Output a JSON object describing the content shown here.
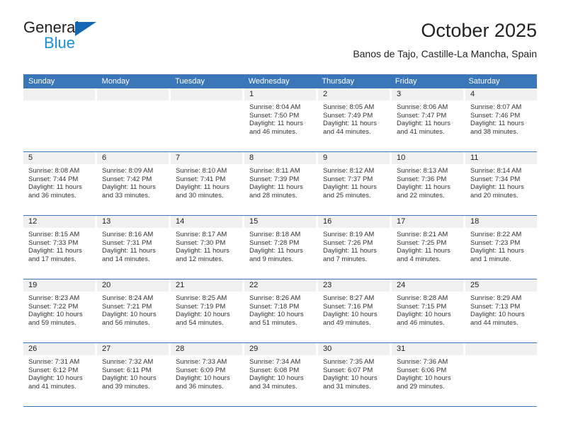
{
  "brand": {
    "name_part1": "General",
    "name_part2": "Blue",
    "accent_color": "#1268b3",
    "blue_text_color": "#1a8fdd"
  },
  "header": {
    "title": "October 2025",
    "subtitle": "Banos de Tajo, Castille-La Mancha, Spain",
    "header_bg_color": "#3b76b8"
  },
  "weekdays": [
    "Sunday",
    "Monday",
    "Tuesday",
    "Wednesday",
    "Thursday",
    "Friday",
    "Saturday"
  ],
  "weeks": [
    [
      {
        "day": "",
        "empty": true,
        "lines": []
      },
      {
        "day": "",
        "empty": true,
        "lines": []
      },
      {
        "day": "",
        "empty": true,
        "lines": []
      },
      {
        "day": "1",
        "empty": false,
        "lines": [
          "Sunrise: 8:04 AM",
          "Sunset: 7:50 PM",
          "Daylight: 11 hours",
          "and 46 minutes."
        ]
      },
      {
        "day": "2",
        "empty": false,
        "lines": [
          "Sunrise: 8:05 AM",
          "Sunset: 7:49 PM",
          "Daylight: 11 hours",
          "and 44 minutes."
        ]
      },
      {
        "day": "3",
        "empty": false,
        "lines": [
          "Sunrise: 8:06 AM",
          "Sunset: 7:47 PM",
          "Daylight: 11 hours",
          "and 41 minutes."
        ]
      },
      {
        "day": "4",
        "empty": false,
        "lines": [
          "Sunrise: 8:07 AM",
          "Sunset: 7:46 PM",
          "Daylight: 11 hours",
          "and 38 minutes."
        ]
      }
    ],
    [
      {
        "day": "5",
        "empty": false,
        "lines": [
          "Sunrise: 8:08 AM",
          "Sunset: 7:44 PM",
          "Daylight: 11 hours",
          "and 36 minutes."
        ]
      },
      {
        "day": "6",
        "empty": false,
        "lines": [
          "Sunrise: 8:09 AM",
          "Sunset: 7:42 PM",
          "Daylight: 11 hours",
          "and 33 minutes."
        ]
      },
      {
        "day": "7",
        "empty": false,
        "lines": [
          "Sunrise: 8:10 AM",
          "Sunset: 7:41 PM",
          "Daylight: 11 hours",
          "and 30 minutes."
        ]
      },
      {
        "day": "8",
        "empty": false,
        "lines": [
          "Sunrise: 8:11 AM",
          "Sunset: 7:39 PM",
          "Daylight: 11 hours",
          "and 28 minutes."
        ]
      },
      {
        "day": "9",
        "empty": false,
        "lines": [
          "Sunrise: 8:12 AM",
          "Sunset: 7:37 PM",
          "Daylight: 11 hours",
          "and 25 minutes."
        ]
      },
      {
        "day": "10",
        "empty": false,
        "lines": [
          "Sunrise: 8:13 AM",
          "Sunset: 7:36 PM",
          "Daylight: 11 hours",
          "and 22 minutes."
        ]
      },
      {
        "day": "11",
        "empty": false,
        "lines": [
          "Sunrise: 8:14 AM",
          "Sunset: 7:34 PM",
          "Daylight: 11 hours",
          "and 20 minutes."
        ]
      }
    ],
    [
      {
        "day": "12",
        "empty": false,
        "lines": [
          "Sunrise: 8:15 AM",
          "Sunset: 7:33 PM",
          "Daylight: 11 hours",
          "and 17 minutes."
        ]
      },
      {
        "day": "13",
        "empty": false,
        "lines": [
          "Sunrise: 8:16 AM",
          "Sunset: 7:31 PM",
          "Daylight: 11 hours",
          "and 14 minutes."
        ]
      },
      {
        "day": "14",
        "empty": false,
        "lines": [
          "Sunrise: 8:17 AM",
          "Sunset: 7:30 PM",
          "Daylight: 11 hours",
          "and 12 minutes."
        ]
      },
      {
        "day": "15",
        "empty": false,
        "lines": [
          "Sunrise: 8:18 AM",
          "Sunset: 7:28 PM",
          "Daylight: 11 hours",
          "and 9 minutes."
        ]
      },
      {
        "day": "16",
        "empty": false,
        "lines": [
          "Sunrise: 8:19 AM",
          "Sunset: 7:26 PM",
          "Daylight: 11 hours",
          "and 7 minutes."
        ]
      },
      {
        "day": "17",
        "empty": false,
        "lines": [
          "Sunrise: 8:21 AM",
          "Sunset: 7:25 PM",
          "Daylight: 11 hours",
          "and 4 minutes."
        ]
      },
      {
        "day": "18",
        "empty": false,
        "lines": [
          "Sunrise: 8:22 AM",
          "Sunset: 7:23 PM",
          "Daylight: 11 hours",
          "and 1 minute."
        ]
      }
    ],
    [
      {
        "day": "19",
        "empty": false,
        "lines": [
          "Sunrise: 8:23 AM",
          "Sunset: 7:22 PM",
          "Daylight: 10 hours",
          "and 59 minutes."
        ]
      },
      {
        "day": "20",
        "empty": false,
        "lines": [
          "Sunrise: 8:24 AM",
          "Sunset: 7:21 PM",
          "Daylight: 10 hours",
          "and 56 minutes."
        ]
      },
      {
        "day": "21",
        "empty": false,
        "lines": [
          "Sunrise: 8:25 AM",
          "Sunset: 7:19 PM",
          "Daylight: 10 hours",
          "and 54 minutes."
        ]
      },
      {
        "day": "22",
        "empty": false,
        "lines": [
          "Sunrise: 8:26 AM",
          "Sunset: 7:18 PM",
          "Daylight: 10 hours",
          "and 51 minutes."
        ]
      },
      {
        "day": "23",
        "empty": false,
        "lines": [
          "Sunrise: 8:27 AM",
          "Sunset: 7:16 PM",
          "Daylight: 10 hours",
          "and 49 minutes."
        ]
      },
      {
        "day": "24",
        "empty": false,
        "lines": [
          "Sunrise: 8:28 AM",
          "Sunset: 7:15 PM",
          "Daylight: 10 hours",
          "and 46 minutes."
        ]
      },
      {
        "day": "25",
        "empty": false,
        "lines": [
          "Sunrise: 8:29 AM",
          "Sunset: 7:13 PM",
          "Daylight: 10 hours",
          "and 44 minutes."
        ]
      }
    ],
    [
      {
        "day": "26",
        "empty": false,
        "lines": [
          "Sunrise: 7:31 AM",
          "Sunset: 6:12 PM",
          "Daylight: 10 hours",
          "and 41 minutes."
        ]
      },
      {
        "day": "27",
        "empty": false,
        "lines": [
          "Sunrise: 7:32 AM",
          "Sunset: 6:11 PM",
          "Daylight: 10 hours",
          "and 39 minutes."
        ]
      },
      {
        "day": "28",
        "empty": false,
        "lines": [
          "Sunrise: 7:33 AM",
          "Sunset: 6:09 PM",
          "Daylight: 10 hours",
          "and 36 minutes."
        ]
      },
      {
        "day": "29",
        "empty": false,
        "lines": [
          "Sunrise: 7:34 AM",
          "Sunset: 6:08 PM",
          "Daylight: 10 hours",
          "and 34 minutes."
        ]
      },
      {
        "day": "30",
        "empty": false,
        "lines": [
          "Sunrise: 7:35 AM",
          "Sunset: 6:07 PM",
          "Daylight: 10 hours",
          "and 31 minutes."
        ]
      },
      {
        "day": "31",
        "empty": false,
        "lines": [
          "Sunrise: 7:36 AM",
          "Sunset: 6:06 PM",
          "Daylight: 10 hours",
          "and 29 minutes."
        ]
      },
      {
        "day": "",
        "empty": true,
        "lines": []
      }
    ]
  ]
}
